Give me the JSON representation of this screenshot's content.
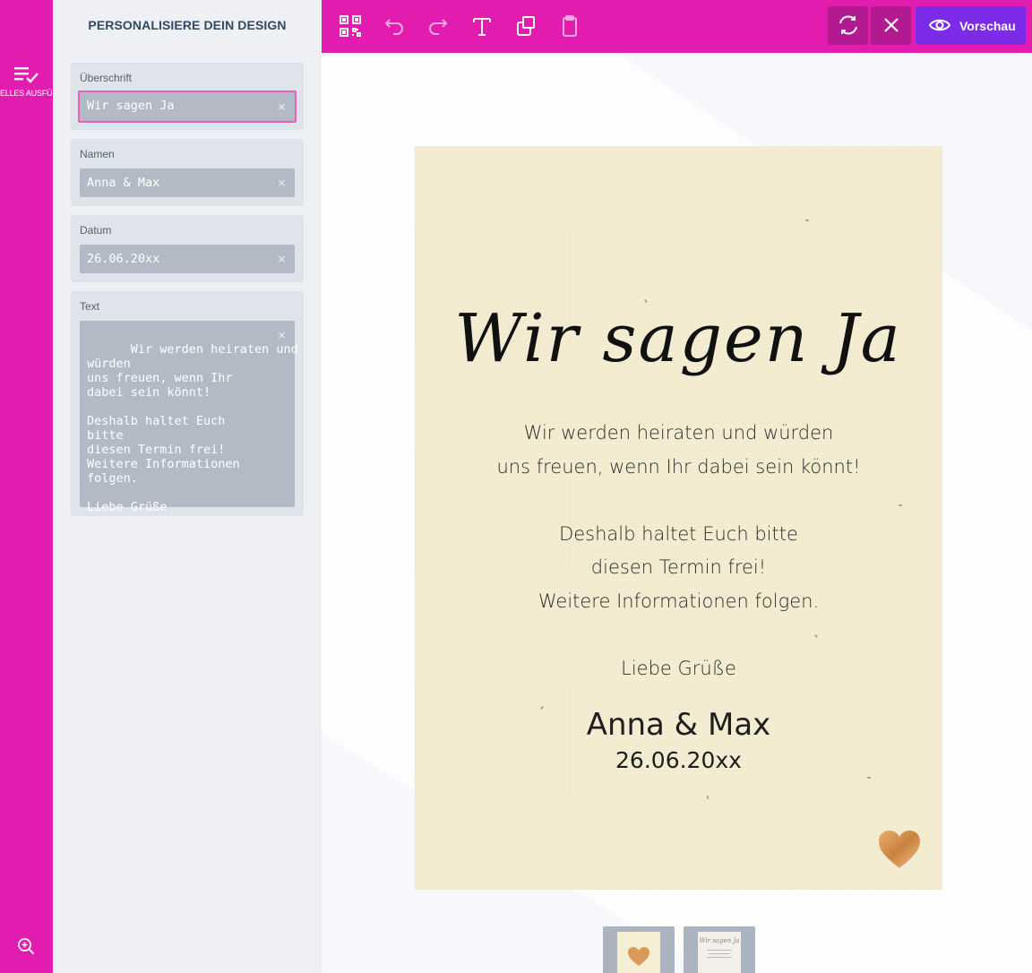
{
  "colors": {
    "brand": "#e31cb0",
    "brand_dark": "#b31a92",
    "preview": "#7c2ce8",
    "panel_bg": "#eef0f4",
    "card_bg": "#f5eed4",
    "heart": "#d99a5a"
  },
  "rail": {
    "tab_label": "ELLES AUSFÜLLEN",
    "tab_icon": "list-check-icon",
    "zoom_icon": "zoom-in-icon"
  },
  "panel": {
    "title": "PERSONALISIERE DEIN DESIGN",
    "fields": [
      {
        "label": "Überschrift",
        "value": "Wir sagen Ja"
      },
      {
        "label": "Namen",
        "value": "Anna & Max"
      },
      {
        "label": "Datum",
        "value": "26.06.20xx"
      },
      {
        "label": "Text",
        "value": "Wir werden heiraten und\nwürden\nuns freuen, wenn Ihr\ndabei sein könnt!\n\nDeshalb haltet Euch\nbitte\ndiesen Termin frei!\nWeitere Informationen\nfolgen.\n\nLiebe Grüße"
      }
    ],
    "clear_glyph": "×"
  },
  "toolbar": {
    "icons": [
      "qr-code-icon",
      "undo-icon",
      "redo-icon",
      "text-icon",
      "layers-icon",
      "clipboard-icon"
    ],
    "refresh_icon": "refresh-icon",
    "close_icon": "close-icon",
    "preview_label": "Vorschau",
    "preview_icon": "eye-icon"
  },
  "card": {
    "headline": "Wir sagen Ja",
    "body_lines_1": [
      "Wir werden heiraten und würden",
      "uns freuen, wenn Ihr dabei sein könnt!"
    ],
    "body_lines_2": [
      "Deshalb haltet Euch bitte",
      "diesen Termin frei!",
      "Weitere Informationen folgen."
    ],
    "body_lines_3": [
      "Liebe Grüße"
    ],
    "names": "Anna & Max",
    "date": "26.06.20xx",
    "heart_icon": "heart-icon"
  },
  "thumbnails": [
    {
      "name": "front",
      "selected": true
    },
    {
      "name": "back",
      "headline": "Wir sagen Ja"
    }
  ]
}
